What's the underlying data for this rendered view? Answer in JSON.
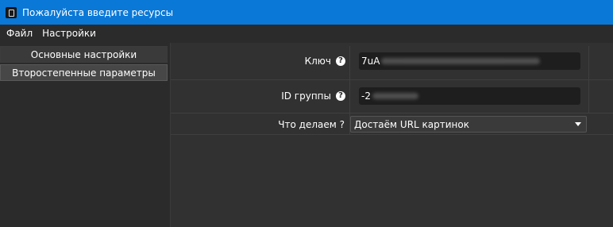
{
  "window": {
    "title": "Пожалуйста введите ресурсы"
  },
  "menu": {
    "items": [
      "Файл",
      "Настройки"
    ]
  },
  "nav": {
    "main_settings": "Основные настройки",
    "secondary_params": "Второстепенные параметры"
  },
  "form": {
    "key": {
      "label": "Ключ",
      "value": "7uA"
    },
    "group_id": {
      "label": "ID группы",
      "value": "-2"
    },
    "action": {
      "label": "Что делаем ?",
      "selected": "Достаём URL картинок"
    }
  }
}
